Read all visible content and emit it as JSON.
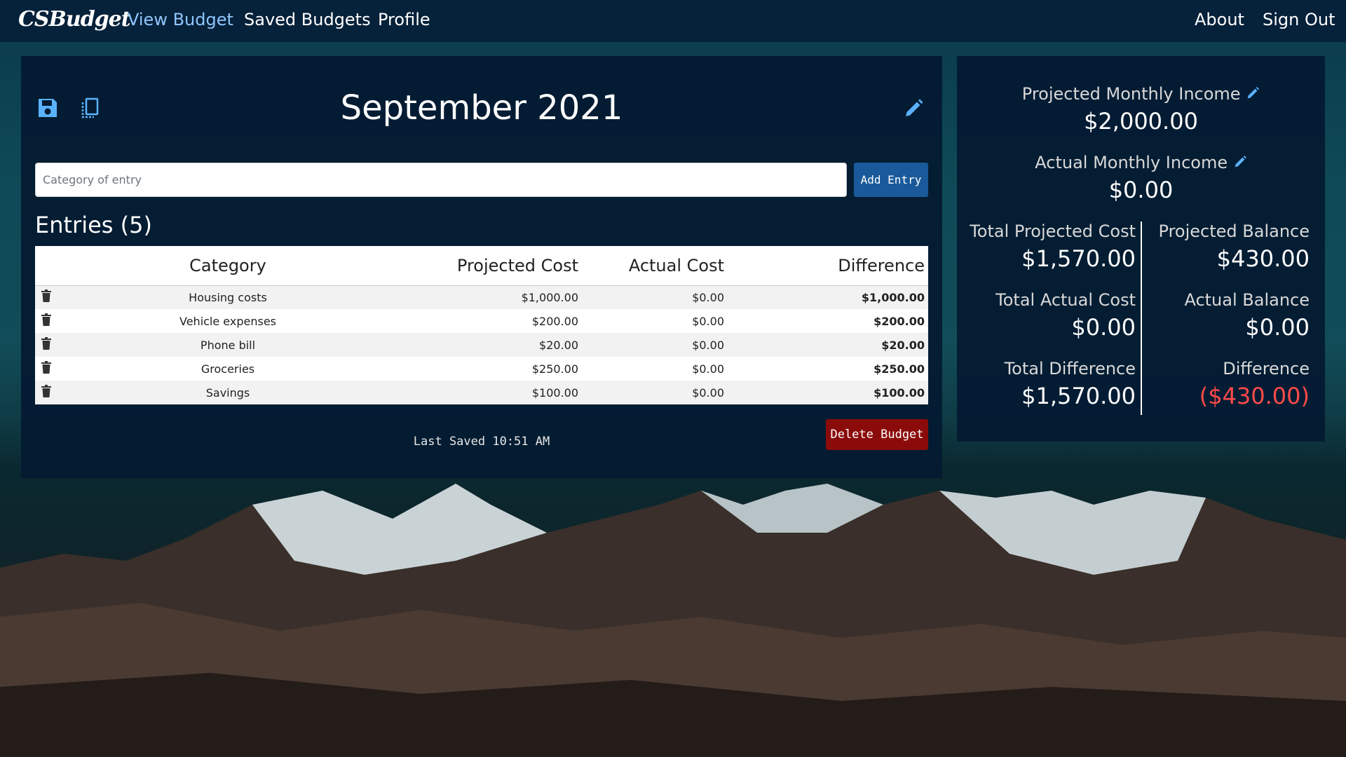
{
  "navbar": {
    "brand": "CSBudget",
    "links": [
      "View Budget",
      "Saved Budgets",
      "Profile"
    ],
    "right_links": [
      "About",
      "Sign Out"
    ]
  },
  "budget": {
    "title": "September 2021",
    "input_placeholder": "Category of entry",
    "add_entry_label": "Add Entry",
    "entries_heading": "Entries (5)",
    "columns": [
      "Category",
      "Projected Cost",
      "Actual Cost",
      "Difference"
    ],
    "rows": [
      {
        "category": "Housing costs",
        "projected": "$1,000.00",
        "actual": "$0.00",
        "difference": "$1,000.00"
      },
      {
        "category": "Vehicle expenses",
        "projected": "$200.00",
        "actual": "$0.00",
        "difference": "$200.00"
      },
      {
        "category": "Phone bill",
        "projected": "$20.00",
        "actual": "$0.00",
        "difference": "$20.00"
      },
      {
        "category": "Groceries",
        "projected": "$250.00",
        "actual": "$0.00",
        "difference": "$250.00"
      },
      {
        "category": "Savings",
        "projected": "$100.00",
        "actual": "$0.00",
        "difference": "$100.00"
      }
    ],
    "last_saved": "Last Saved 10:51 AM",
    "delete_label": "Delete Budget"
  },
  "summary": {
    "projected_income_label": "Projected Monthly Income",
    "projected_income": "$2,000.00",
    "actual_income_label": "Actual Monthly Income",
    "actual_income": "$0.00",
    "total_projected_cost_label": "Total Projected Cost",
    "total_projected_cost": "$1,570.00",
    "projected_balance_label": "Projected Balance",
    "projected_balance": "$430.00",
    "total_actual_cost_label": "Total Actual Cost",
    "total_actual_cost": "$0.00",
    "actual_balance_label": "Actual Balance",
    "actual_balance": "$0.00",
    "total_difference_label": "Total Difference",
    "total_difference": "$1,570.00",
    "difference_label": "Difference",
    "difference": "($430.00)"
  },
  "colors": {
    "navbar_bg": "#06213a",
    "panel_bg": "#041b32",
    "active_link": "#8fc6ff",
    "icon_accent": "#5ab2ff",
    "add_button": "#1a5a9a",
    "delete_button": "#8b0b0b",
    "negative": "#ff4a4a"
  },
  "icons": [
    "save-icon",
    "copy-icon",
    "edit-icon",
    "trash-icon"
  ]
}
